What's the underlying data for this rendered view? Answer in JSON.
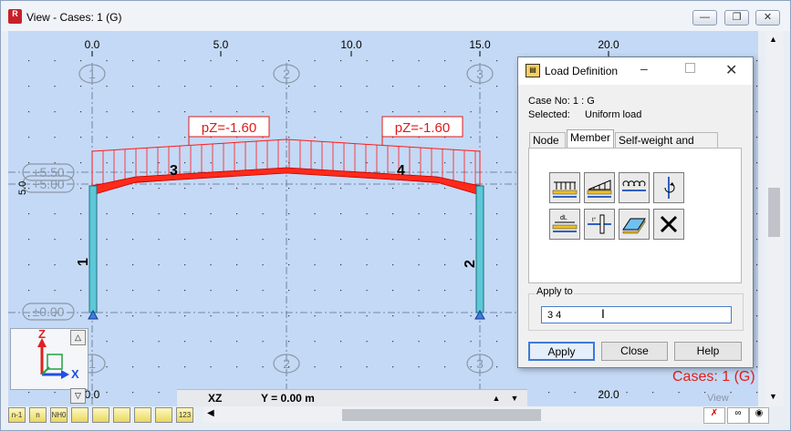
{
  "window": {
    "title": "View - Cases: 1 (G)",
    "app_icon": "R"
  },
  "canvas": {
    "top_scale": [
      "0.0",
      "5.0",
      "10.0",
      "15.0",
      "20.0"
    ],
    "bottom_scale": [
      "0.0",
      "20.0"
    ],
    "left_scale": [
      "5.0"
    ],
    "axis_bubbles": [
      "1",
      "2",
      "3"
    ],
    "level_bubbles": [
      "+5.50",
      "+5.00",
      "±0.00"
    ],
    "load_labels": [
      "pZ=-1.60",
      "pZ=-1.60"
    ],
    "member_labels": [
      "3",
      "4",
      "1",
      "2"
    ],
    "cases_label": "Cases: 1 (G)",
    "view_label": "View"
  },
  "statusbar": {
    "plane": "XZ",
    "y_coord": "Y = 0.00 m"
  },
  "axes_widget": {
    "z": "Z",
    "x": "X"
  },
  "dialog": {
    "title": "Load Definition",
    "case_label": "Case No: 1 : G",
    "selected_label": "Selected:",
    "selected_value": "Uniform load",
    "tabs": [
      "Node",
      "Member",
      "Self-weight and mass"
    ],
    "apply_to_label": "Apply to",
    "apply_to_value": "3 4",
    "buttons": {
      "apply": "Apply",
      "close": "Close",
      "help": "Help"
    }
  },
  "bottom_tools": [
    "n-1",
    "n",
    "NH0",
    "",
    "",
    "",
    "",
    "",
    "123"
  ],
  "colors": {
    "canvas_bg": "#c4d9f5",
    "load": "#ff1a1a",
    "column": "#5cc8d8",
    "cases_text": "#e0201c"
  }
}
